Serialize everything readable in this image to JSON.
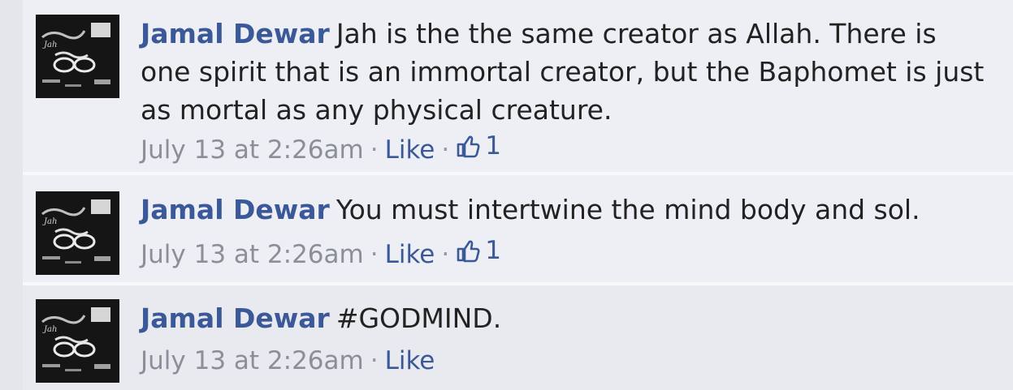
{
  "comments": [
    {
      "author": "Jamal Dewar",
      "text": "Jah is the the same creator as Allah. There is one spirit that is an immortal creator, but the Baphomet is just as mortal as any physical creature.",
      "timestamp": "July 13 at 2:26am",
      "like_label": "Like",
      "separator": "·",
      "like_count": "1"
    },
    {
      "author": "Jamal Dewar",
      "text": "You must intertwine the mind body and sol.",
      "timestamp": "July 13 at 2:26am",
      "like_label": "Like",
      "separator": "·",
      "like_count": "1"
    },
    {
      "author": "Jamal Dewar",
      "text": "#GODMIND.",
      "timestamp": "July 13 at 2:26am",
      "like_label": "Like",
      "separator": "·"
    }
  ],
  "icons": {
    "like_count_icon": "thumbs-up-icon",
    "avatar": "profile-picture"
  },
  "colors": {
    "link": "#3b5998",
    "meta": "#8a8f99",
    "background": "#edeff4"
  }
}
